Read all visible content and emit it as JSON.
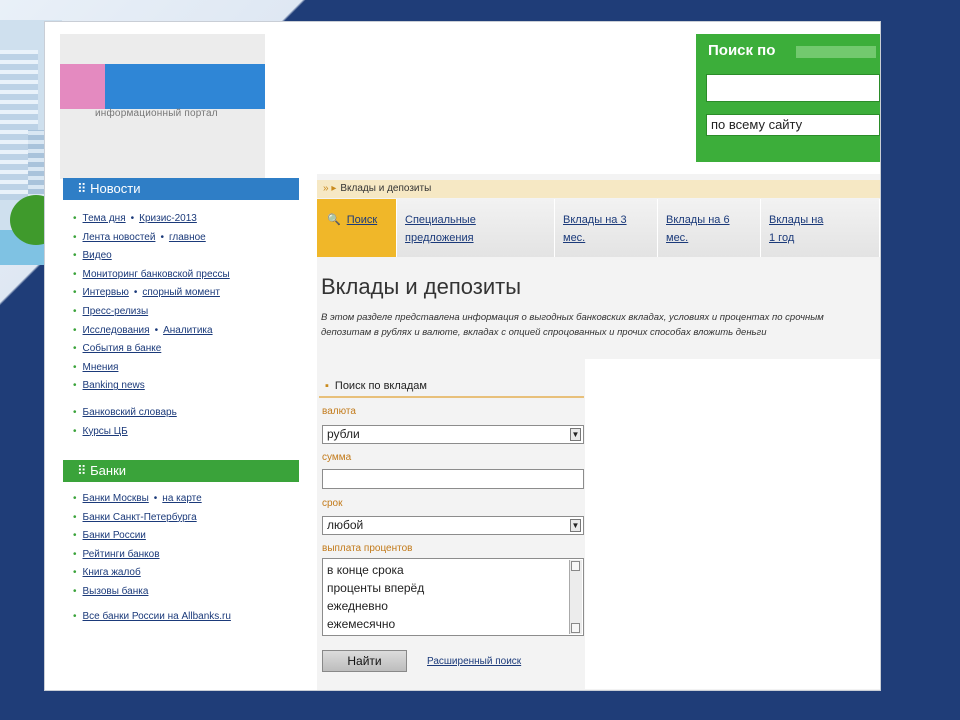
{
  "header": {
    "logo_tagline": "информационный портал",
    "search_title": "Поиск по",
    "search_scope": "по всему сайту"
  },
  "sidebar": {
    "news_title": "Новости",
    "news_items": [
      {
        "a": "Тема дня",
        "b": "Кризис-2013"
      },
      {
        "a": "Лента новостей",
        "b": "главное"
      },
      {
        "a": "Видео"
      },
      {
        "a": "Мониторинг банковской прессы"
      },
      {
        "a": "Интервью",
        "b": "спорный момент"
      },
      {
        "a": "Пресс-релизы"
      },
      {
        "a": "Исследования",
        "b": "Аналитика"
      },
      {
        "a": "События в банке"
      },
      {
        "a": "Мнения"
      },
      {
        "a": "Banking news"
      },
      {
        "a": "Банковский словарь"
      },
      {
        "a": "Курсы ЦБ"
      }
    ],
    "banks_title": "Банки",
    "banks_items": [
      {
        "a": "Банки Москвы",
        "b": "на карте"
      },
      {
        "a": "Банки Санкт-Петербурга"
      },
      {
        "a": "Банки России"
      },
      {
        "a": "Рейтинги банков"
      },
      {
        "a": "Книга жалоб"
      },
      {
        "a": "Вызовы банка"
      },
      {
        "a": "Все банки России на Allbanks.ru"
      }
    ]
  },
  "content": {
    "breadcrumb": "Вклады и депозиты",
    "tabs": [
      {
        "line1": "Поиск",
        "line2": ""
      },
      {
        "line1": "Специальные",
        "line2": "предложения"
      },
      {
        "line1": "Вклады на 3",
        "line2": "мес."
      },
      {
        "line1": "Вклады на 6",
        "line2": "мес."
      },
      {
        "line1": "Вклады на",
        "line2": "1 год"
      }
    ],
    "title": "Вклады и депозиты",
    "intro": "В этом разделе представлена информация о выгодных банковских вкладах, условиях и процентах по срочным депозитам в рублях и валюте, вкладах с опцией спроцованных и прочих способах вложить деньги"
  },
  "filter": {
    "heading": "Поиск по вкладам",
    "currency_label": "валюта",
    "currency_value": "рубли",
    "amount_label": "сумма",
    "term_label": "срок",
    "term_value": "любой",
    "payout_label": "выплата процентов",
    "payout_options": [
      "в конце срока",
      "проценты вперёд",
      "ежедневно",
      "ежемесячно"
    ],
    "find_button": "Найти",
    "advanced_link": "Расширенный поиск"
  }
}
